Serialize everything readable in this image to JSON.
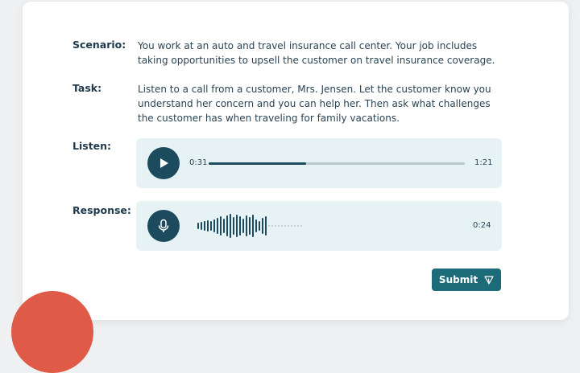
{
  "scenario": {
    "label": "Scenario:",
    "text": "You work at an auto and travel insurance call center. Your job includes taking opportunities to upsell the customer on travel insurance coverage."
  },
  "task": {
    "label": "Task:",
    "text": "Listen to a call from a customer, Mrs. Jensen. Let the customer know you understand her concern and you can help her. Then ask what challenges the customer has when traveling for family vacations."
  },
  "listen": {
    "label": "Listen:",
    "current_time": "0:31",
    "duration": "1:21",
    "progress": 0.38
  },
  "response": {
    "label": "Response:",
    "recorded_time": "0:24"
  },
  "submit": {
    "label": "Submit"
  },
  "colors": {
    "primary": "#1c4b5e",
    "button": "#1c6b78",
    "player_bg": "#e6f2f4",
    "accent": "#e05a48"
  },
  "icons": {
    "play": "play-icon",
    "mic": "microphone-icon",
    "send": "send-icon"
  }
}
